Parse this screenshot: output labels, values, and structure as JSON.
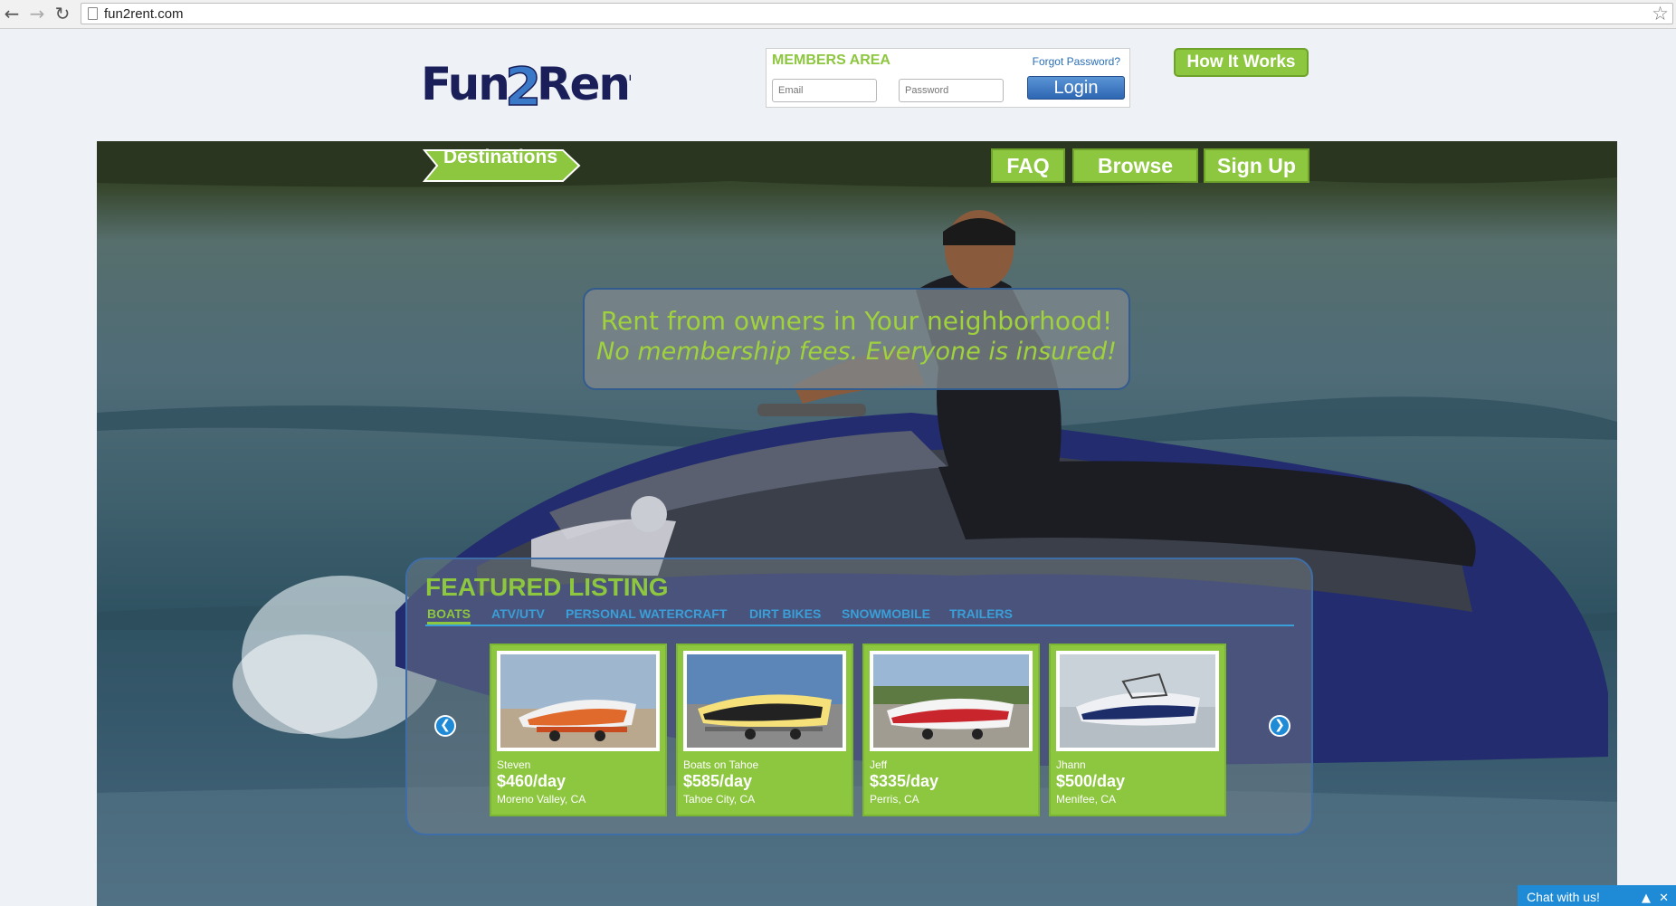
{
  "browser": {
    "url": "fun2rent.com"
  },
  "header": {
    "members": {
      "title": "MEMBERS AREA",
      "forgot": "Forgot Password?",
      "email_placeholder": "Email",
      "password_placeholder": "Password",
      "login": "Login"
    },
    "how_it_works": "How It Works"
  },
  "hero": {
    "destinations": "Destinations",
    "nav": {
      "faq": "FAQ",
      "browse": "Browse",
      "signup": "Sign Up"
    },
    "tagline1": "Rent from owners in Your neighborhood!",
    "tagline2": "No membership fees. Everyone is insured!"
  },
  "featured": {
    "title": "FEATURED LISTING",
    "tabs": [
      "BOATS",
      "ATV/UTV",
      "PERSONAL WATERCRAFT",
      "DIRT BIKES",
      "SNOWMOBILE",
      "TRAILERS"
    ],
    "listings": [
      {
        "owner": "Steven",
        "price": "$460/day",
        "location": "Moreno Valley, CA"
      },
      {
        "owner": "Boats on Tahoe",
        "price": "$585/day",
        "location": "Tahoe City, CA"
      },
      {
        "owner": "Jeff",
        "price": "$335/day",
        "location": "Perris, CA"
      },
      {
        "owner": "Jhann",
        "price": "$500/day",
        "location": "Menifee, CA"
      }
    ]
  },
  "chat": {
    "label": "Chat with us!"
  },
  "colors": {
    "brand_green": "#8dc63f",
    "brand_blue": "#1f8ad6",
    "logo_navy": "#1a1f5a",
    "logo_blue": "#3a78c8"
  }
}
